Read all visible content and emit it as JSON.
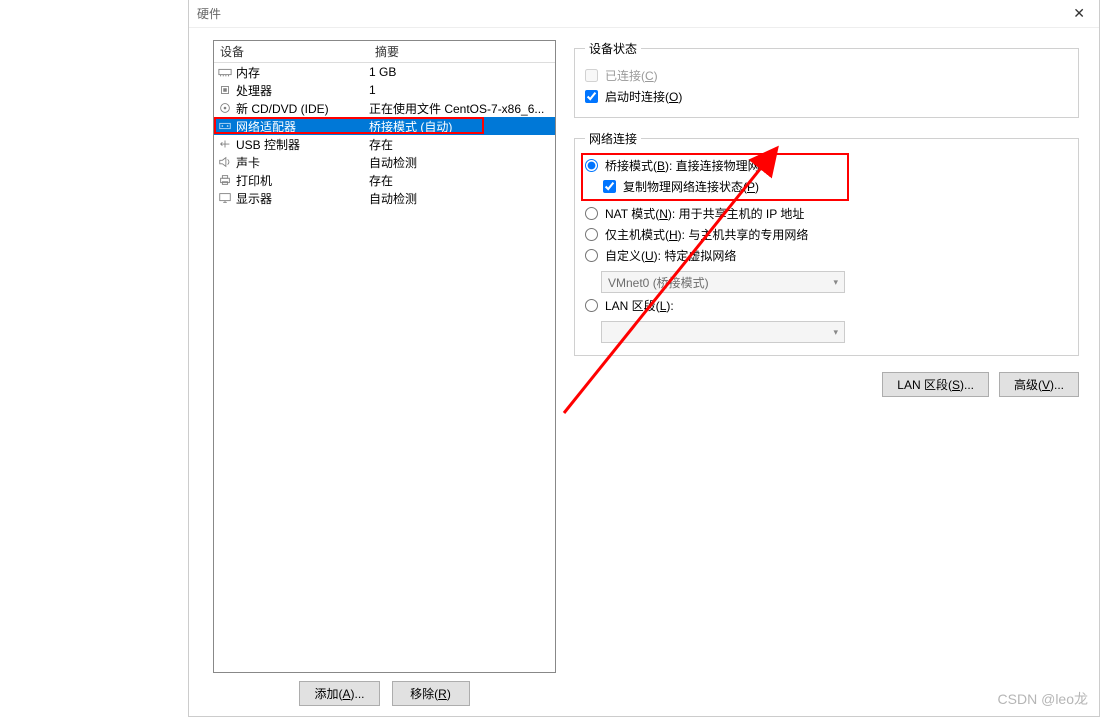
{
  "title_partial": "硬件",
  "device_list": {
    "header_name": "设备",
    "header_summary": "摘要",
    "rows": [
      {
        "icon": "memory-icon",
        "name": "内存",
        "summary": "1 GB",
        "selected": false
      },
      {
        "icon": "cpu-icon",
        "name": "处理器",
        "summary": "1",
        "selected": false
      },
      {
        "icon": "cd-icon",
        "name": "新 CD/DVD (IDE)",
        "summary": "正在使用文件 CentOS-7-x86_6...",
        "selected": false
      },
      {
        "icon": "network-icon",
        "name": "网络适配器",
        "summary": "桥接模式 (自动)",
        "selected": true
      },
      {
        "icon": "usb-icon",
        "name": "USB 控制器",
        "summary": "存在",
        "selected": false
      },
      {
        "icon": "sound-icon",
        "name": "声卡",
        "summary": "自动检测",
        "selected": false
      },
      {
        "icon": "printer-icon",
        "name": "打印机",
        "summary": "存在",
        "selected": false
      },
      {
        "icon": "display-icon",
        "name": "显示器",
        "summary": "自动检测",
        "selected": false
      }
    ]
  },
  "buttons": {
    "add": "添加(A)...",
    "remove": "移除(R)"
  },
  "device_status": {
    "legend": "设备状态",
    "connected": "已连接(C)",
    "connect_on_start": "启动时连接(O)"
  },
  "network": {
    "legend": "网络连接",
    "bridged": "桥接模式(B): 直接连接物理网络",
    "replicate": "复制物理网络连接状态(P)",
    "nat": "NAT 模式(N): 用于共享主机的 IP 地址",
    "hostonly": "仅主机模式(H): 与主机共享的专用网络",
    "custom": "自定义(U): 特定虚拟网络",
    "custom_value": "VMnet0 (桥接模式)",
    "lan": "LAN 区段(L):",
    "lan_value": "",
    "lan_segments_btn": "LAN 区段(S)...",
    "advanced_btn": "高级(V)..."
  },
  "watermark": "CSDN @leo龙"
}
